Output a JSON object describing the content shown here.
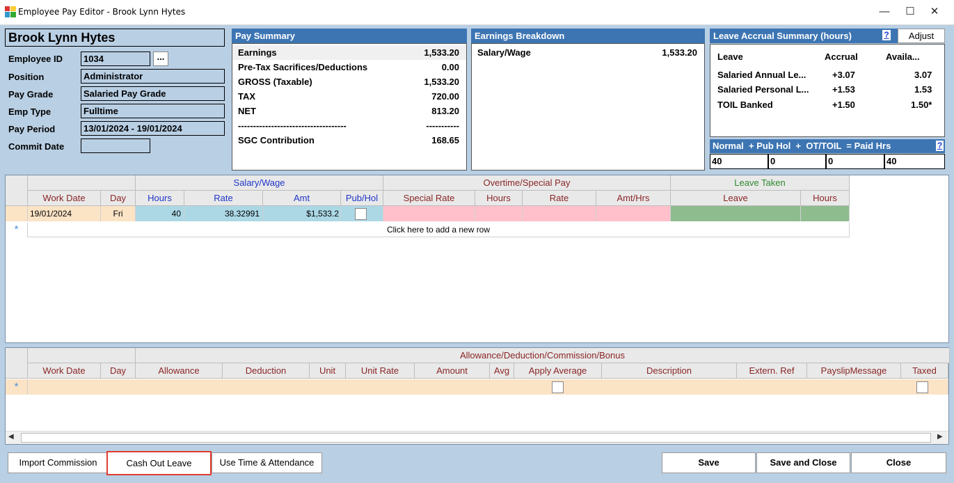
{
  "window": {
    "title": "Employee Pay Editor - Brook Lynn Hytes"
  },
  "employee": {
    "name": "Brook Lynn Hytes",
    "labels": {
      "id": "Employee ID",
      "position": "Position",
      "pay_grade": "Pay Grade",
      "emp_type": "Emp Type",
      "pay_period": "Pay Period",
      "commit_date": "Commit Date"
    },
    "id": "1034",
    "browse_label": "...",
    "position": "Administrator",
    "pay_grade": "Salaried Pay Grade",
    "emp_type": "Fulltime",
    "pay_period": "13/01/2024 - 19/01/2024",
    "commit_date": ""
  },
  "pay_summary": {
    "title": "Pay Summary",
    "rows": [
      {
        "label": "Earnings",
        "value": "1,533.20"
      },
      {
        "label": "Pre-Tax Sacrifices/Deductions",
        "value": "0.00"
      },
      {
        "label": "GROSS (Taxable)",
        "value": "1,533.20"
      },
      {
        "label": "TAX",
        "value": "720.00"
      },
      {
        "label": "NET",
        "value": "813.20"
      },
      {
        "label": "------------------------------------",
        "value": "-----------"
      },
      {
        "label": "SGC Contribution",
        "value": "168.65"
      }
    ]
  },
  "earnings_breakdown": {
    "title": "Earnings Breakdown",
    "rows": [
      {
        "label": "Salary/Wage",
        "value": "1,533.20"
      }
    ]
  },
  "leave_accrual": {
    "title": "Leave Accrual Summary (hours)",
    "help": "?",
    "adjust_label": "Adjust",
    "headers": {
      "leave": "Leave",
      "accrual": "Accrual",
      "avail": "Availa..."
    },
    "rows": [
      {
        "leave": "Salaried Annual Le...",
        "accrual": "+3.07",
        "avail": "3.07"
      },
      {
        "leave": "Salaried Personal L...",
        "accrual": "+1.53",
        "avail": "1.53"
      },
      {
        "leave": "TOIL Banked",
        "accrual": "+1.50",
        "avail": "1.50*"
      }
    ]
  },
  "hours_bar": {
    "label": "Normal  + Pub Hol  +  OT/TOIL  = Paid Hrs",
    "help": "?",
    "normal": "40",
    "pub_hol": "0",
    "ot_toil": "0",
    "paid": "40"
  },
  "main_grid": {
    "groups": {
      "salary": "Salary/Wage",
      "overtime": "Overtime/Special Pay",
      "leave": "Leave Taken"
    },
    "headers": {
      "work_date": "Work Date",
      "day": "Day",
      "hours": "Hours",
      "rate": "Rate",
      "amt": "Amt",
      "pubhol": "Pub/Hol",
      "special_rate": "Special Rate",
      "ot_hours": "Hours",
      "ot_rate": "Rate",
      "amt_hrs": "Amt/Hrs",
      "leave": "Leave",
      "leave_hours": "Hours"
    },
    "rows": [
      {
        "work_date": "19/01/2024",
        "day": "Fri",
        "hours": "40",
        "rate": "38.32991",
        "amt": "$1,533.2"
      }
    ],
    "new_row_marker": "*",
    "new_row_text": "Click here to add a new row"
  },
  "allowance_grid": {
    "group": "Allowance/Deduction/Commission/Bonus",
    "headers": {
      "work_date": "Work Date",
      "day": "Day",
      "allowance": "Allowance",
      "deduction": "Deduction",
      "unit": "Unit",
      "unit_rate": "Unit Rate",
      "amount": "Amount",
      "avg": "Avg",
      "apply_average": "Apply Average",
      "description": "Description",
      "extern_ref": "Extern. Ref",
      "payslip_message": "PayslipMessage",
      "taxed": "Taxed"
    },
    "new_row_marker": "*"
  },
  "buttons": {
    "import_commission": "Import Commission",
    "cash_out_leave": "Cash Out Leave",
    "use_time_attendance": "Use Time & Attendance",
    "save": "Save",
    "save_close": "Save and Close",
    "close": "Close"
  },
  "colors": {
    "window_bg": "#b9cfe4",
    "panel_header": "#3d75b3",
    "salary_cells": "#acd8e6",
    "overtime_cells": "#ffc0cb",
    "leave_cells": "#8fbc8f",
    "highlight_border": "#e03c31"
  }
}
